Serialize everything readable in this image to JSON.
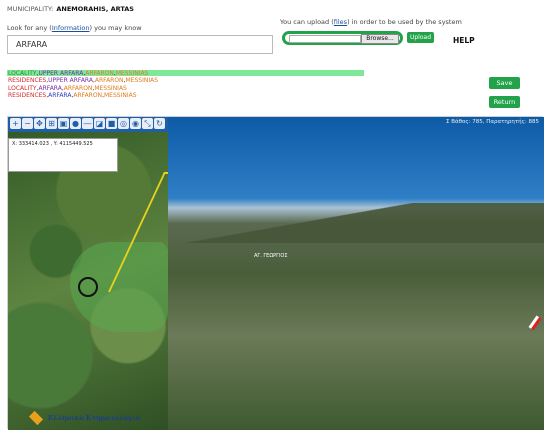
{
  "header": {
    "municipality_label": "MUNICIPALITY:",
    "municipality_value": "ANEMORAHIS, ARTAS"
  },
  "search": {
    "prompt_before": "Look for any (",
    "prompt_link": "Information",
    "prompt_after": ") you may know",
    "value": "ARFARA"
  },
  "upload": {
    "text_before": "You can upload (",
    "text_link": "files",
    "text_after": ") in order to be used by the system",
    "browse_label": "Browse...",
    "upload_button": "Upload",
    "help_label": "HELP"
  },
  "locations": [
    {
      "type": "LOCALITY",
      "place": "UPPER ARFARA",
      "area": "ARFARON",
      "region": "MESSINIAS"
    },
    {
      "type": "RESIDENCES",
      "place": "UPPER ARFARA",
      "area": "ARFARON",
      "region": "MESSINIAS"
    },
    {
      "type": "LOCALITY",
      "place": "ARFARA",
      "area": "ARFARON",
      "region": "MESSINIAS"
    },
    {
      "type": "RESIDENCES",
      "place": "ARFARA",
      "area": "ARFARON",
      "region": "MESSINIAS"
    }
  ],
  "actions": {
    "save_label": "Save",
    "return_label": "Return"
  },
  "map": {
    "toolbar_2d_label": "2D",
    "coords_text": "X: 333414.023 , Y: 4115449.525",
    "status_text": "Σ Βάθος: 785, Παρατηρητής: 885",
    "place_label": "ΑΓ. ΓΕΩΡΓΙΟΣ",
    "logo_text": "Ελληνικό Κτηματολόγιο"
  },
  "colors": {
    "accent_green": "#22a34a",
    "toolbar_blue": "#1f5fa8"
  }
}
